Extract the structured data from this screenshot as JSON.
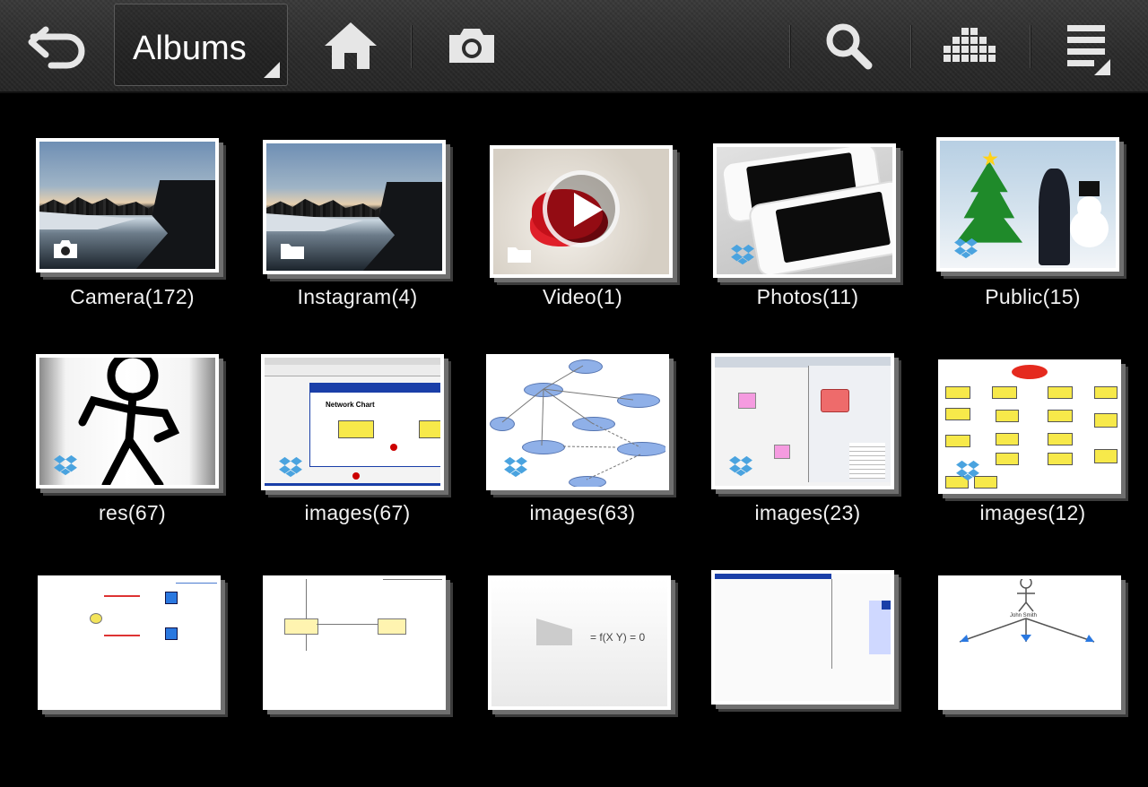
{
  "actionbar": {
    "back_icon": "back-arrow-icon",
    "dropdown_label": "Albums",
    "home_icon": "home-icon",
    "camera_icon": "camera-icon",
    "search_icon": "search-icon",
    "view_icon": "grid-view-icon",
    "menu_icon": "overflow-menu-icon"
  },
  "albums": [
    {
      "label": "Camera(172)",
      "badge": "camera-icon"
    },
    {
      "label": "Instagram(4)",
      "badge": "folder-icon"
    },
    {
      "label": "Video(1)",
      "badge": "folder-icon"
    },
    {
      "label": "Photos(11)",
      "badge": "dropbox-icon"
    },
    {
      "label": "Public(15)",
      "badge": "dropbox-icon"
    },
    {
      "label": "res(67)",
      "badge": "dropbox-icon"
    },
    {
      "label": "images(67)",
      "badge": "dropbox-icon"
    },
    {
      "label": "images(63)",
      "badge": "dropbox-icon"
    },
    {
      "label": "images(23)",
      "badge": "dropbox-icon"
    },
    {
      "label": "images(12)",
      "badge": "dropbox-icon"
    }
  ],
  "thumb_text": {
    "network_chart": "Network Chart",
    "john_smith": "John Smith",
    "formula": "= f(X Y) = 0"
  },
  "colors": {
    "background": "#000000",
    "actionbar": "#2e2e2e",
    "label": "#f2f2f2",
    "dropbox": "#4aa3df"
  }
}
